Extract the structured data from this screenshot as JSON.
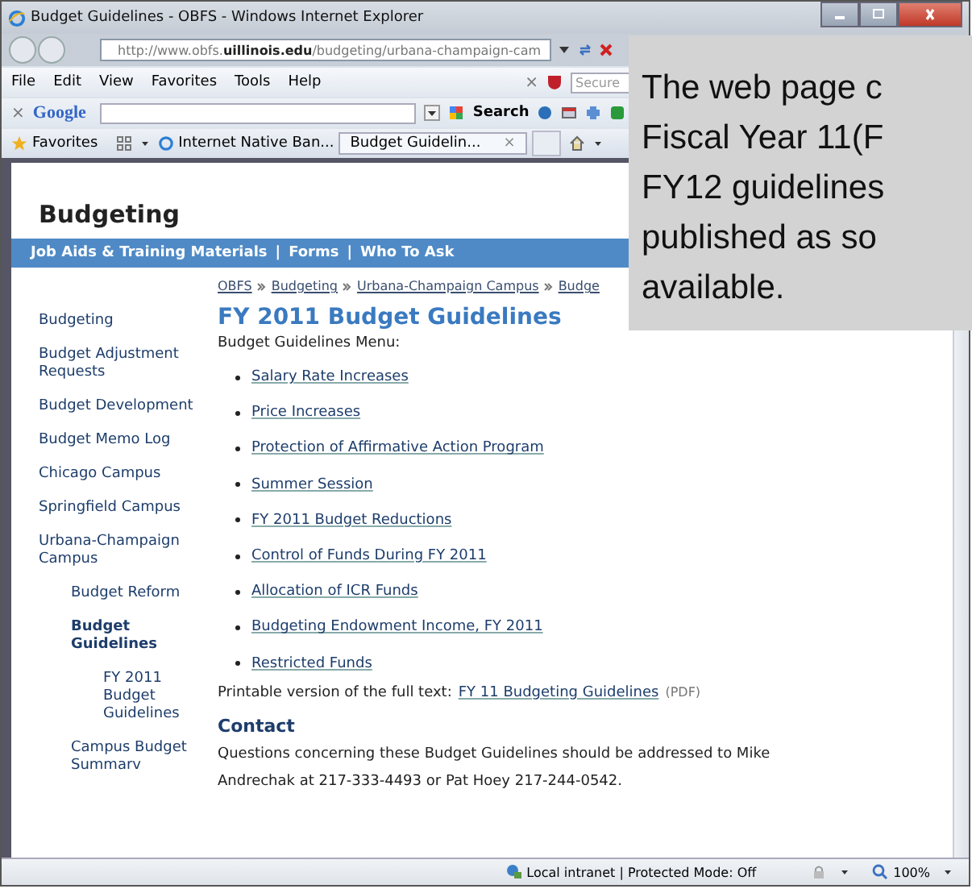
{
  "window": {
    "title": "Budget Guidelines - OBFS - Windows Internet Explorer"
  },
  "address_bar": {
    "url_prefix": "http://www.obfs.",
    "url_domain": "uillinois.edu",
    "url_path": "/budgeting/urbana-champaign-cam"
  },
  "menu_bar": [
    "File",
    "Edit",
    "View",
    "Favorites",
    "Tools",
    "Help"
  ],
  "security_search": {
    "close": "×",
    "placeholder": "Secure"
  },
  "google_bar": {
    "close": "×",
    "logo": "Google",
    "search_button": "Search"
  },
  "favorites_bar": {
    "favorites": "Favorites",
    "links": [
      {
        "label": "Internet Native Ban..."
      }
    ],
    "tabs": [
      {
        "label": "Budget Guidelin...",
        "close": "×",
        "selected": true
      }
    ]
  },
  "site": {
    "title": "Budgeting",
    "separator": "|",
    "nav": [
      {
        "label": "Job Aids & Training Materials"
      },
      {
        "label": "Forms"
      },
      {
        "label": "Who To Ask"
      }
    ]
  },
  "breadcrumb": [
    "OBFS",
    "Budgeting",
    "Urbana-Champaign Campus",
    "Budge"
  ],
  "sidebar": {
    "items": [
      {
        "label": "Budgeting",
        "selected": false
      },
      {
        "label": "Budget Adjustment Requests",
        "selected": false
      },
      {
        "label": "Budget Development",
        "selected": false
      },
      {
        "label": "Budget Memo Log",
        "selected": false
      },
      {
        "label": "Chicago Campus",
        "selected": false
      },
      {
        "label": "Springfield Campus",
        "selected": false
      },
      {
        "label": "Urbana-Champaign Campus",
        "selected": false,
        "children": [
          {
            "label": "Budget Reform",
            "selected": false
          },
          {
            "label": "Budget Guidelines",
            "selected": true,
            "children": [
              {
                "label": "FY 2011 Budget Guidelines",
                "selected": false
              }
            ]
          },
          {
            "label": "Campus Budget Summarv",
            "selected": false
          }
        ]
      }
    ]
  },
  "content": {
    "heading": "FY 2011 Budget Guidelines",
    "menu_label": "Budget Guidelines Menu:",
    "menu_items": [
      "Salary Rate Increases",
      "Price Increases",
      "Protection of Affirmative Action Program",
      "Summer Session",
      "FY 2011 Budget Reductions",
      "Control of Funds During FY 2011",
      "Allocation of ICR Funds",
      "Budgeting Endowment Income, FY 2011",
      "Restricted Funds"
    ],
    "printable": {
      "text": "Printable version of the full text:",
      "link": "FY 11 Budgeting Guidelines",
      "note": "(PDF)"
    },
    "contact": {
      "heading": "Contact",
      "text": "Questions concerning these Budget Guidelines should be addressed to Mike Andrechak at 217-333-4493 or Pat Hoey 217-244-0542."
    }
  },
  "status_bar": {
    "zone": "Local intranet | Protected Mode: Off",
    "zoom": "100%"
  },
  "callout": {
    "lines": [
      "The web page c",
      "Fiscal Year 11(F",
      "FY12 guidelines",
      "published as so",
      "available."
    ]
  }
}
